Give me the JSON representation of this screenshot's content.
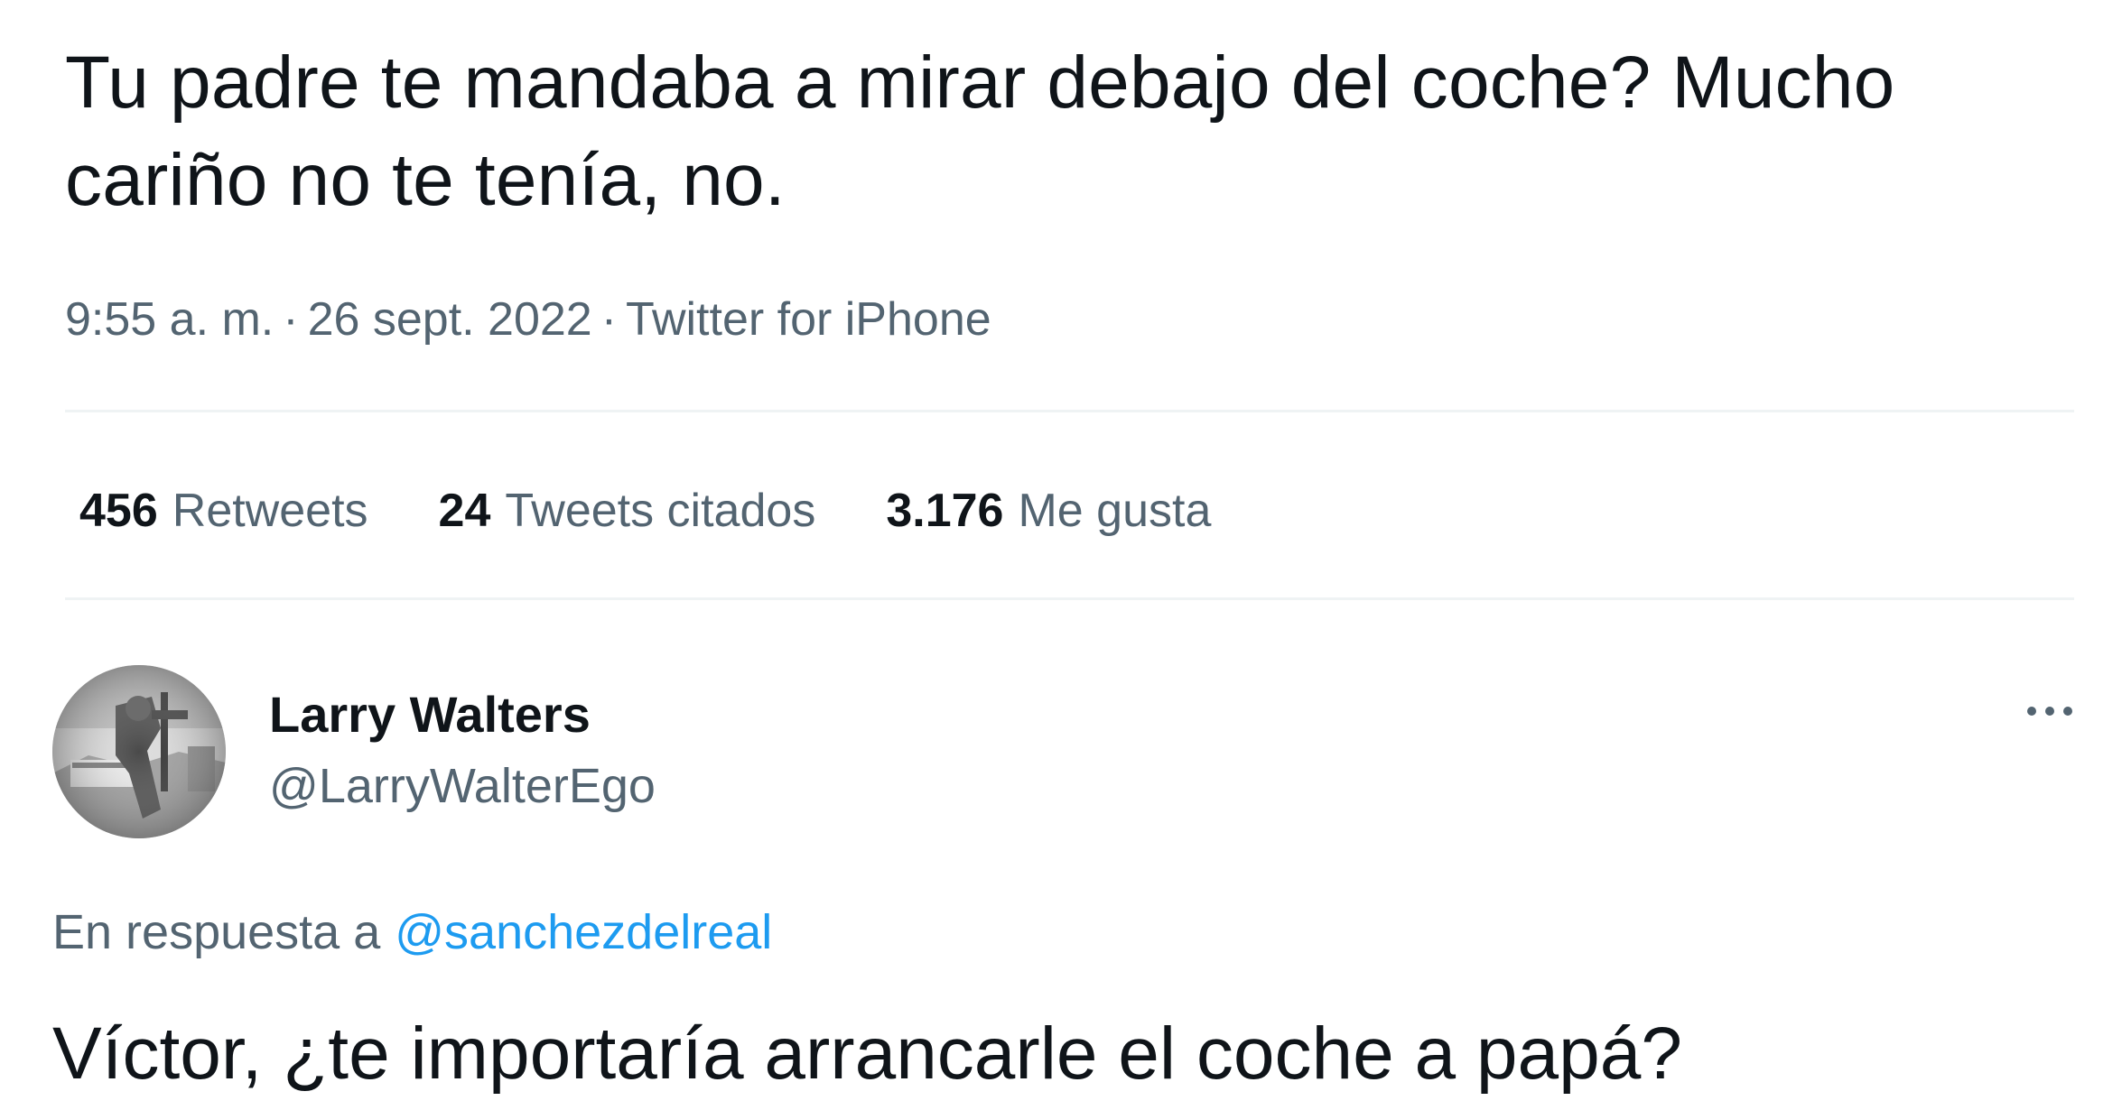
{
  "tweet": {
    "text": "Tu padre te mandaba a mirar debajo del coche? Mucho cariño no te tenía, no.",
    "time": "9:55 a. m.",
    "date": "26 sept. 2022",
    "source": "Twitter for iPhone",
    "separator": "·",
    "stats": [
      {
        "count": "456",
        "label": "Retweets"
      },
      {
        "count": "24",
        "label": "Tweets citados"
      },
      {
        "count": "3.176",
        "label": "Me gusta"
      }
    ]
  },
  "reply": {
    "display_name": "Larry Walters",
    "handle": "@LarryWalterEgo",
    "reply_prefix": "En respuesta a",
    "reply_to": "@sanchezdelreal",
    "text": "Víctor, ¿te importaría arrancarle el coche a papá?",
    "avatar_icon": "profile-photo-grayscale",
    "more_icon": "more-options-icon"
  },
  "colors": {
    "text_primary": "#0f1419",
    "text_secondary": "#536471",
    "link": "#1d9bf0",
    "divider": "#eff3f4"
  }
}
